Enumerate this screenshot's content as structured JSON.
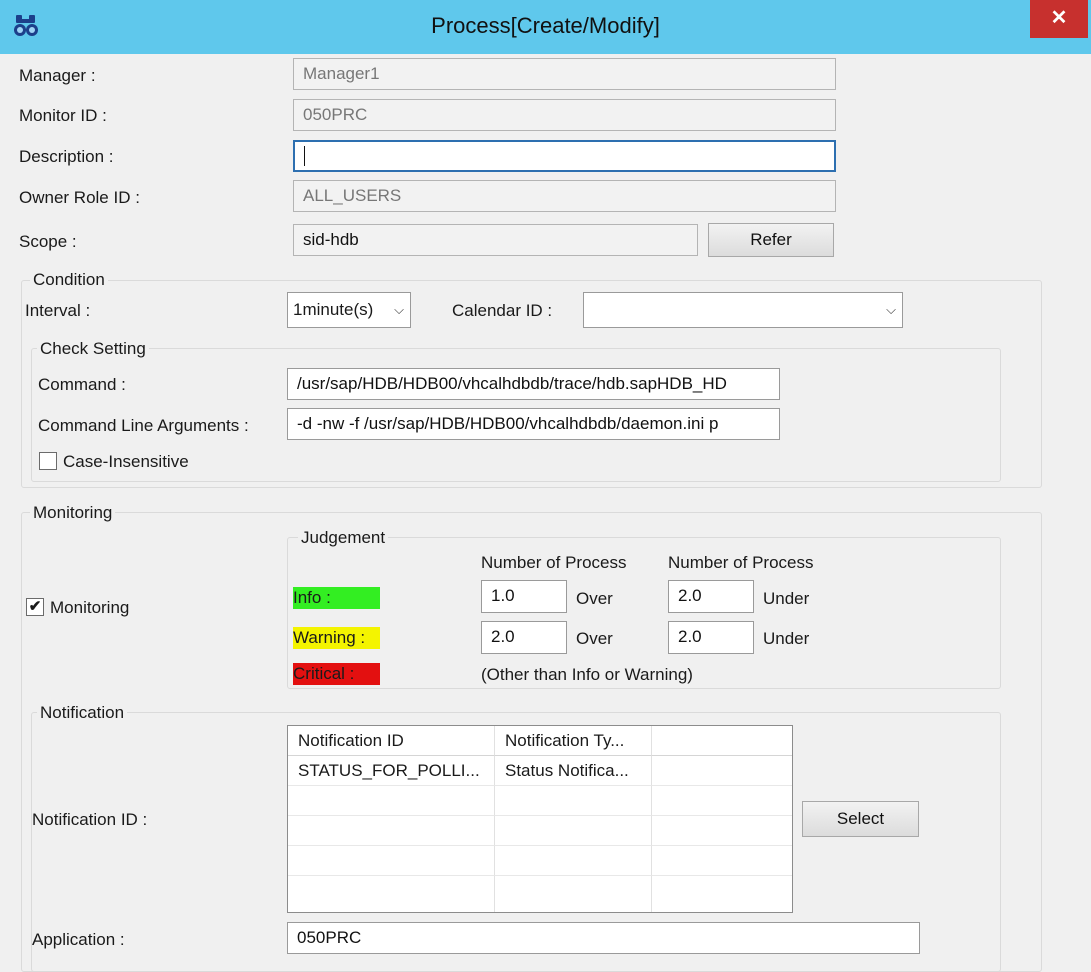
{
  "window": {
    "title": "Process[Create/Modify]",
    "close_symbol": "✕",
    "app_icon": "binoculars-icon"
  },
  "form": {
    "manager_label": "Manager :",
    "manager_value": "Manager1",
    "monitor_id_label": "Monitor ID :",
    "monitor_id_value": "050PRC",
    "description_label": "Description :",
    "description_value": "",
    "owner_role_label": "Owner Role ID :",
    "owner_role_value": "ALL_USERS",
    "scope_label": "Scope :",
    "scope_value": "sid-hdb",
    "refer_button": "Refer"
  },
  "condition": {
    "group_label": "Condition",
    "interval_label": "Interval :",
    "interval_value": "1minute(s)",
    "calendar_label": "Calendar ID :",
    "calendar_value": ""
  },
  "check_setting": {
    "group_label": "Check Setting",
    "command_label": "Command :",
    "command_value": "/usr/sap/HDB/HDB00/vhcalhdbdb/trace/hdb.sapHDB_HD",
    "args_label": "Command Line Arguments :",
    "args_value": "-d -nw -f /usr/sap/HDB/HDB00/vhcalhdbdb/daemon.ini p",
    "case_insensitive_label": "Case-Insensitive",
    "case_insensitive_checked": false
  },
  "monitoring": {
    "group_label": "Monitoring",
    "checkbox_label": "Monitoring",
    "checked": true,
    "check_mark": "✔",
    "judgement": {
      "group_label": "Judgement",
      "col1_header": "Number of Process",
      "col2_header": "Number of Process",
      "info_label": "Info :",
      "info_color": "#33ee22",
      "info_min": "1.0",
      "info_min_op": "Over",
      "info_max": "2.0",
      "info_max_op": "Under",
      "warning_label": "Warning :",
      "warning_color": "#f4f400",
      "warning_min": "2.0",
      "warning_min_op": "Over",
      "warning_max": "2.0",
      "warning_max_op": "Under",
      "critical_label": "Critical :",
      "critical_color": "#e31010",
      "critical_note": "(Other than Info or Warning)"
    }
  },
  "notification": {
    "group_label": "Notification",
    "id_label": "Notification ID :",
    "columns": [
      "Notification ID",
      "Notification Ty..."
    ],
    "rows": [
      [
        "STATUS_FOR_POLLI...",
        "Status Notifica..."
      ]
    ],
    "select_button": "Select",
    "application_label": "Application :",
    "application_value": "050PRC"
  }
}
